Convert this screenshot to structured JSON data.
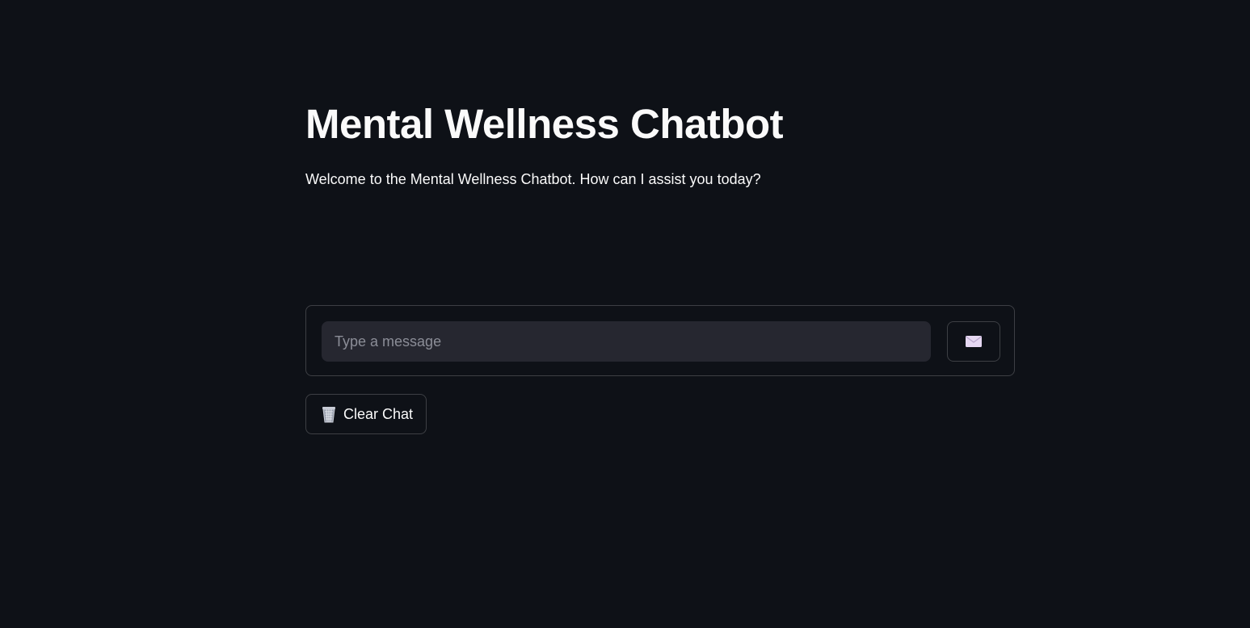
{
  "header": {
    "title": "Mental Wellness Chatbot",
    "subtitle": "Welcome to the Mental Wellness Chatbot. How can I assist you today?"
  },
  "chat_form": {
    "input_placeholder": "Type a message",
    "input_value": "",
    "send_icon": "envelope-icon"
  },
  "actions": {
    "clear_icon": "wastebasket-icon",
    "clear_label": "Clear Chat"
  },
  "colors": {
    "background": "#0e1117",
    "input_background": "#262730",
    "text": "#fafafa",
    "placeholder": "#8b8d97",
    "border": "#3a3c45",
    "envelope_fill": "#e6d8f2"
  }
}
